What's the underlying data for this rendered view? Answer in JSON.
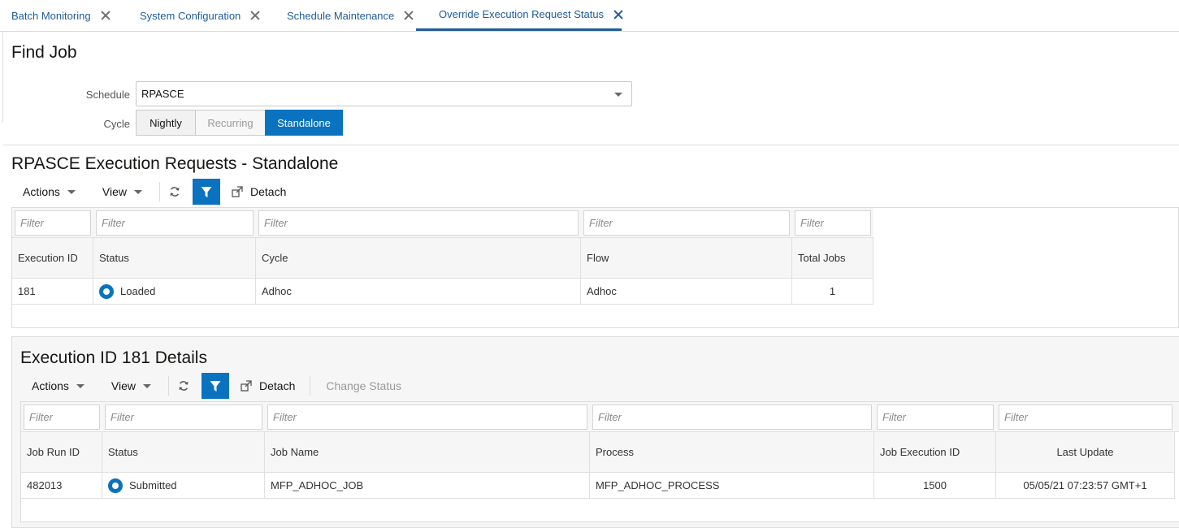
{
  "tabs": [
    {
      "label": "Batch Monitoring",
      "active": false
    },
    {
      "label": "System Configuration",
      "active": false
    },
    {
      "label": "Schedule Maintenance",
      "active": false
    },
    {
      "label": "Override Execution Request Status",
      "active": true
    }
  ],
  "find_job": {
    "title": "Find Job",
    "schedule_label": "Schedule",
    "schedule_value": "RPASCE",
    "cycle_label": "Cycle",
    "cycle_options": [
      "Nightly",
      "Recurring",
      "Standalone"
    ],
    "cycle_selected": "Standalone"
  },
  "requests": {
    "title": "RPASCE Execution Requests - Standalone",
    "toolbar": {
      "actions": "Actions",
      "view": "View",
      "refresh_icon": "refresh-icon",
      "filter_icon": "filter-icon",
      "detach": "Detach"
    },
    "filter_placeholder": "Filter",
    "columns": [
      "Execution ID",
      "Status",
      "Cycle",
      "Flow",
      "Total Jobs"
    ],
    "rows": [
      {
        "execution_id": "181",
        "status": "Loaded",
        "cycle": "Adhoc",
        "flow": "Adhoc",
        "total_jobs": "1"
      }
    ]
  },
  "details": {
    "title": "Execution ID 181 Details",
    "toolbar": {
      "actions": "Actions",
      "view": "View",
      "detach": "Detach",
      "change_status": "Change Status"
    },
    "filter_placeholder": "Filter",
    "columns": [
      "Job Run ID",
      "Status",
      "Job Name",
      "Process",
      "Job Execution ID",
      "Last Update"
    ],
    "rows": [
      {
        "job_run_id": "482013",
        "status": "Submitted",
        "job_name": "MFP_ADHOC_JOB",
        "process": "MFP_ADHOC_PROCESS",
        "job_execution_id": "1500",
        "last_update": "05/05/21 07:23:57 GMT+1"
      }
    ]
  },
  "colors": {
    "accent": "#0a72bf",
    "link": "#1f5c99"
  }
}
